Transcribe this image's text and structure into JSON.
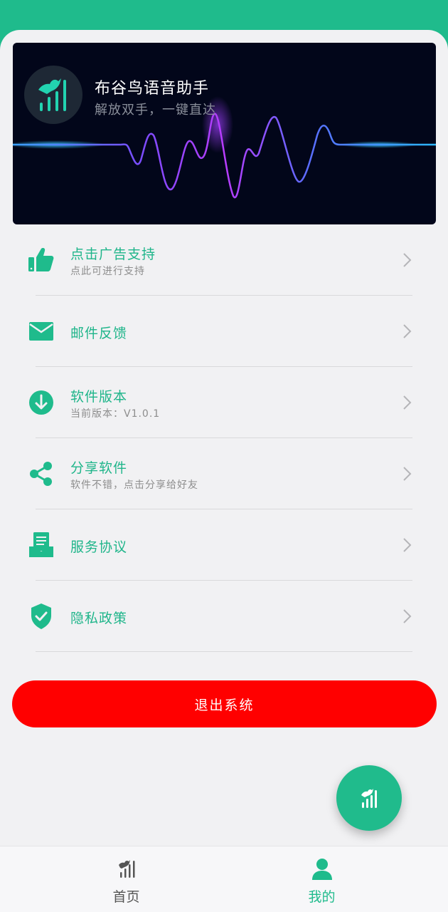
{
  "app": {
    "title": "布谷鸟语音助手",
    "subtitle": "解放双手，一键直达"
  },
  "colors": {
    "brand_green": "#1fbb8c",
    "logout_red": "#ff0000",
    "banner_bg": "#02061a"
  },
  "menu": [
    {
      "icon": "thumbs-up-icon",
      "label": "点击广告支持",
      "sub": "点此可进行支持"
    },
    {
      "icon": "mail-icon",
      "label": "邮件反馈",
      "sub": ""
    },
    {
      "icon": "download-icon",
      "label": "软件版本",
      "sub": "当前版本：V1.0.1"
    },
    {
      "icon": "share-icon",
      "label": "分享软件",
      "sub": "软件不错，点击分享给好友"
    },
    {
      "icon": "agreement-icon",
      "label": "服务协议",
      "sub": ""
    },
    {
      "icon": "shield-check-icon",
      "label": "隐私政策",
      "sub": ""
    }
  ],
  "logout_label": "退出系统",
  "bottom_nav": {
    "home_label": "首页",
    "mine_label": "我的",
    "active": "mine"
  }
}
